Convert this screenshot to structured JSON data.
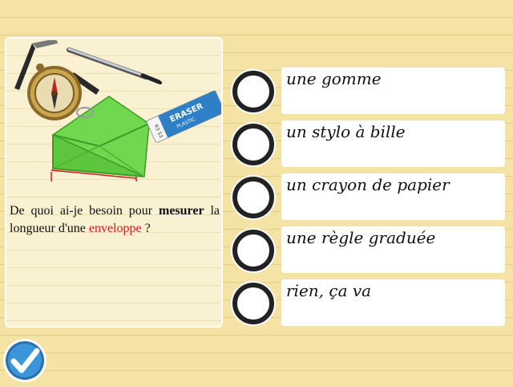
{
  "question": {
    "part1": "De quoi ai-je besoin pour ",
    "bold": "mesurer",
    "part2": " la longueur d'une ",
    "highlight": "enveloppe",
    "part3": " ?",
    "eraser_label": "ERASER",
    "eraser_sublabel": "PLASTIC",
    "eraser_code": "R3 53"
  },
  "options": [
    {
      "label": "une gomme"
    },
    {
      "label": "un stylo à bille"
    },
    {
      "label": "un crayon de papier"
    },
    {
      "label": "une règle graduée"
    },
    {
      "label": "rien, ça va"
    }
  ],
  "colors": {
    "background": "#f5e3a6",
    "card": "#f9f1d2",
    "highlight": "#e0141c",
    "envelope": "#66d64a",
    "validate": "#3a96d8"
  },
  "icons": {
    "validate": "checkmark-icon",
    "radio": "radio-circle"
  }
}
